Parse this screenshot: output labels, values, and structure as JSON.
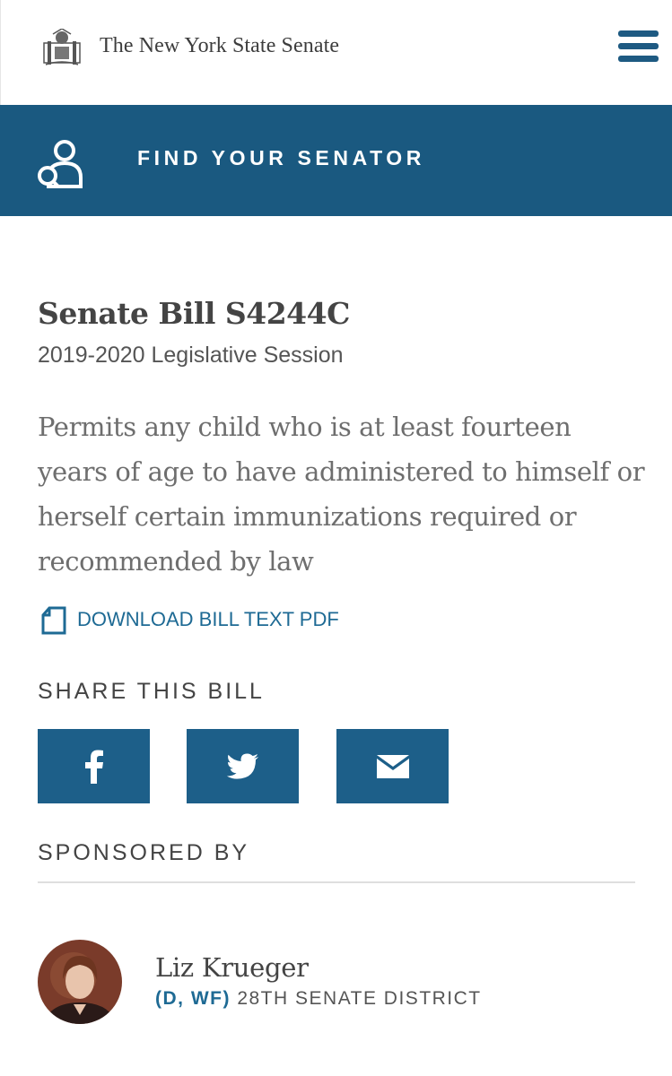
{
  "header": {
    "site_title": "The New York State Senate"
  },
  "find_senator": {
    "label": "FIND YOUR SENATOR"
  },
  "bill": {
    "title": "Senate Bill S4244C",
    "session": "2019-2020 Legislative Session",
    "summary": "Permits any child who is at least fourteen years of age to have administered to himself or herself certain immunizations required or recommended by law",
    "download_label": "DOWNLOAD BILL TEXT PDF"
  },
  "share": {
    "title": "SHARE THIS BILL",
    "buttons": [
      "facebook-icon",
      "twitter-icon",
      "email-icon"
    ]
  },
  "sponsor": {
    "heading": "SPONSORED BY",
    "name": "Liz Krueger",
    "party": "(D, WF)",
    "district": "28TH SENATE DISTRICT"
  },
  "colors": {
    "brand_blue": "#1a5980",
    "link_blue": "#1e6a94"
  }
}
